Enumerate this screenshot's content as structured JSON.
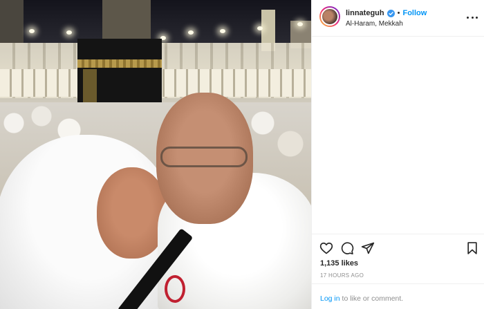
{
  "header": {
    "username": "linnateguh",
    "separator": "•",
    "follow_label": "Follow",
    "location": "Al-Haram, Mekkah"
  },
  "post": {
    "likes": "1,135 likes",
    "timestamp": "17 HOURS AGO"
  },
  "footer": {
    "login_link": "Log in",
    "login_suffix": " to like or comment."
  },
  "colors": {
    "accent_blue": "#0095f6",
    "text_primary": "#262626",
    "text_secondary": "#8e8e8e",
    "border": "#efefef"
  },
  "icons": [
    "verified-badge-icon",
    "more-options-icon",
    "heart-icon",
    "comment-icon",
    "share-icon",
    "bookmark-icon"
  ]
}
